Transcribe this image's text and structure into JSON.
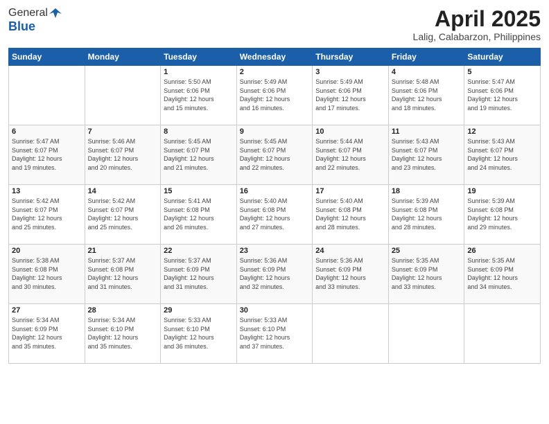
{
  "header": {
    "logo_general": "General",
    "logo_blue": "Blue",
    "month_title": "April 2025",
    "location": "Lalig, Calabarzon, Philippines"
  },
  "weekdays": [
    "Sunday",
    "Monday",
    "Tuesday",
    "Wednesday",
    "Thursday",
    "Friday",
    "Saturday"
  ],
  "weeks": [
    [
      {
        "day": "",
        "info": ""
      },
      {
        "day": "",
        "info": ""
      },
      {
        "day": "1",
        "info": "Sunrise: 5:50 AM\nSunset: 6:06 PM\nDaylight: 12 hours\nand 15 minutes."
      },
      {
        "day": "2",
        "info": "Sunrise: 5:49 AM\nSunset: 6:06 PM\nDaylight: 12 hours\nand 16 minutes."
      },
      {
        "day": "3",
        "info": "Sunrise: 5:49 AM\nSunset: 6:06 PM\nDaylight: 12 hours\nand 17 minutes."
      },
      {
        "day": "4",
        "info": "Sunrise: 5:48 AM\nSunset: 6:06 PM\nDaylight: 12 hours\nand 18 minutes."
      },
      {
        "day": "5",
        "info": "Sunrise: 5:47 AM\nSunset: 6:06 PM\nDaylight: 12 hours\nand 19 minutes."
      }
    ],
    [
      {
        "day": "6",
        "info": "Sunrise: 5:47 AM\nSunset: 6:07 PM\nDaylight: 12 hours\nand 19 minutes."
      },
      {
        "day": "7",
        "info": "Sunrise: 5:46 AM\nSunset: 6:07 PM\nDaylight: 12 hours\nand 20 minutes."
      },
      {
        "day": "8",
        "info": "Sunrise: 5:45 AM\nSunset: 6:07 PM\nDaylight: 12 hours\nand 21 minutes."
      },
      {
        "day": "9",
        "info": "Sunrise: 5:45 AM\nSunset: 6:07 PM\nDaylight: 12 hours\nand 22 minutes."
      },
      {
        "day": "10",
        "info": "Sunrise: 5:44 AM\nSunset: 6:07 PM\nDaylight: 12 hours\nand 22 minutes."
      },
      {
        "day": "11",
        "info": "Sunrise: 5:43 AM\nSunset: 6:07 PM\nDaylight: 12 hours\nand 23 minutes."
      },
      {
        "day": "12",
        "info": "Sunrise: 5:43 AM\nSunset: 6:07 PM\nDaylight: 12 hours\nand 24 minutes."
      }
    ],
    [
      {
        "day": "13",
        "info": "Sunrise: 5:42 AM\nSunset: 6:07 PM\nDaylight: 12 hours\nand 25 minutes."
      },
      {
        "day": "14",
        "info": "Sunrise: 5:42 AM\nSunset: 6:07 PM\nDaylight: 12 hours\nand 25 minutes."
      },
      {
        "day": "15",
        "info": "Sunrise: 5:41 AM\nSunset: 6:08 PM\nDaylight: 12 hours\nand 26 minutes."
      },
      {
        "day": "16",
        "info": "Sunrise: 5:40 AM\nSunset: 6:08 PM\nDaylight: 12 hours\nand 27 minutes."
      },
      {
        "day": "17",
        "info": "Sunrise: 5:40 AM\nSunset: 6:08 PM\nDaylight: 12 hours\nand 28 minutes."
      },
      {
        "day": "18",
        "info": "Sunrise: 5:39 AM\nSunset: 6:08 PM\nDaylight: 12 hours\nand 28 minutes."
      },
      {
        "day": "19",
        "info": "Sunrise: 5:39 AM\nSunset: 6:08 PM\nDaylight: 12 hours\nand 29 minutes."
      }
    ],
    [
      {
        "day": "20",
        "info": "Sunrise: 5:38 AM\nSunset: 6:08 PM\nDaylight: 12 hours\nand 30 minutes."
      },
      {
        "day": "21",
        "info": "Sunrise: 5:37 AM\nSunset: 6:08 PM\nDaylight: 12 hours\nand 31 minutes."
      },
      {
        "day": "22",
        "info": "Sunrise: 5:37 AM\nSunset: 6:09 PM\nDaylight: 12 hours\nand 31 minutes."
      },
      {
        "day": "23",
        "info": "Sunrise: 5:36 AM\nSunset: 6:09 PM\nDaylight: 12 hours\nand 32 minutes."
      },
      {
        "day": "24",
        "info": "Sunrise: 5:36 AM\nSunset: 6:09 PM\nDaylight: 12 hours\nand 33 minutes."
      },
      {
        "day": "25",
        "info": "Sunrise: 5:35 AM\nSunset: 6:09 PM\nDaylight: 12 hours\nand 33 minutes."
      },
      {
        "day": "26",
        "info": "Sunrise: 5:35 AM\nSunset: 6:09 PM\nDaylight: 12 hours\nand 34 minutes."
      }
    ],
    [
      {
        "day": "27",
        "info": "Sunrise: 5:34 AM\nSunset: 6:09 PM\nDaylight: 12 hours\nand 35 minutes."
      },
      {
        "day": "28",
        "info": "Sunrise: 5:34 AM\nSunset: 6:10 PM\nDaylight: 12 hours\nand 35 minutes."
      },
      {
        "day": "29",
        "info": "Sunrise: 5:33 AM\nSunset: 6:10 PM\nDaylight: 12 hours\nand 36 minutes."
      },
      {
        "day": "30",
        "info": "Sunrise: 5:33 AM\nSunset: 6:10 PM\nDaylight: 12 hours\nand 37 minutes."
      },
      {
        "day": "",
        "info": ""
      },
      {
        "day": "",
        "info": ""
      },
      {
        "day": "",
        "info": ""
      }
    ]
  ]
}
